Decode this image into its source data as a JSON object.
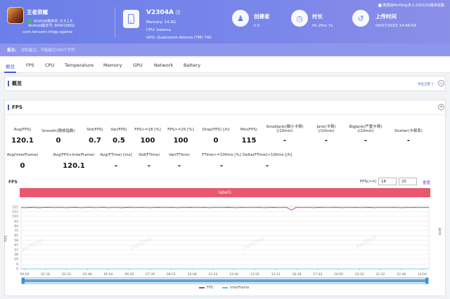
{
  "header": {
    "app_name": "王者荣耀",
    "android_version": "Android版本名: 8.4.1.6",
    "android_code": "Android版本号: 804010602",
    "package": "com.tencent.tmgp.sgame",
    "device_name": "V2304A",
    "memory": "Memory: 14.9G",
    "cpu": "CPU: kalama",
    "gpu": "GPU: Qualcomm Adreno (TM) 740",
    "creator_label": "创建者",
    "creator_value": "li li",
    "duration_label": "时长",
    "duration_value": "0h 25m 7s",
    "upload_label": "上传时间",
    "upload_value": "04/07/2023 14:46:54",
    "source_note": "数据由PerfDog(8.1.230120)版本收集",
    "note_label": "备注:",
    "note_placeholder": "添加备注，不能超过200个字符"
  },
  "tabs": [
    "概览",
    "FPS",
    "CPU",
    "Temperature",
    "Memory",
    "GPU",
    "Network",
    "Battery"
  ],
  "overview": {
    "title": "概览",
    "export_label": "导出全部"
  },
  "fps_panel": {
    "title": "FPS",
    "row1": [
      {
        "label": "Avg(FPS)",
        "value": "120.1"
      },
      {
        "label": "Smooth(稳帧指数)",
        "value": "0"
      },
      {
        "label": "Std(FPS)",
        "value": "0.7"
      },
      {
        "label": "Var(FPS)",
        "value": "0.5"
      },
      {
        "label": "FPS>=18 [%]",
        "value": "100"
      },
      {
        "label": "FPS>=25 [%]",
        "value": "100"
      },
      {
        "label": "Drop(FPS) [/h]",
        "value": "0"
      },
      {
        "label": "Min(FPS)",
        "value": "115"
      },
      {
        "label": "SmallJank(微小卡顿)",
        "label2": "(/10min)",
        "value": "-"
      },
      {
        "label": "Jank(卡顿)",
        "label2": "(/10min)",
        "value": "-"
      },
      {
        "label": "BigJank(严重卡顿)",
        "label2": "(/10min)",
        "value": "-"
      },
      {
        "label": "Stutter(卡顿率)",
        "value": "-"
      }
    ],
    "row2": [
      {
        "label": "Avg(InterFrame)",
        "value": "0"
      },
      {
        "label": "Avg(FPS+InterFrame)",
        "value": "120.1"
      },
      {
        "label": "Avg(FTime) [ms]",
        "value": "-"
      },
      {
        "label": "Std(FTime)",
        "value": "-"
      },
      {
        "label": "Var(FTime)",
        "value": "-"
      },
      {
        "label": "FTime>=100ms [%]",
        "value": "-"
      },
      {
        "label": "Delta(FTime)>100ms [/h]",
        "value": "-"
      }
    ]
  },
  "chart_controls": {
    "title": "FPS",
    "threshold_label": "FPS(>=)",
    "threshold_low": "18",
    "threshold_high": "25",
    "reset_label": "重置",
    "band_label": "label1",
    "watermark": "PerfDog"
  },
  "colors": {
    "accent": "#4a5bd9",
    "fps_line": "#b03ca0",
    "interframe_line": "#4fc3e8",
    "band": "#e9586e"
  },
  "chart_data": {
    "type": "line",
    "ylabel": "FPS",
    "ylabel_right": "Jank",
    "ylim": [
      0,
      121
    ],
    "yticks": [
      "121",
      "112",
      "103",
      "93",
      "84",
      "75",
      "65",
      "56",
      "47",
      "37",
      "28",
      "19",
      "9",
      "0"
    ],
    "xticks": [
      "00:00",
      "01:16",
      "02:32",
      "03:48",
      "05:04",
      "06:20",
      "07:36",
      "08:52",
      "10:08",
      "11:24",
      "12:40",
      "13:56",
      "15:12",
      "16:28",
      "17:44",
      "19:00",
      "20:16",
      "21:32",
      "22:48",
      "24:04"
    ],
    "series": [
      {
        "name": "FPS",
        "values": [
          120.1,
          119.8,
          120.3,
          120.0,
          119.6,
          120.2,
          120.4,
          119.9,
          120.1,
          120.0,
          119.7,
          120.2,
          120.3,
          119.8,
          120.1,
          120.2,
          119.9,
          120.0,
          120.4,
          119.8,
          120.1,
          120.0,
          119.6,
          120.3,
          120.1,
          119.9,
          120.2,
          120.0,
          119.8,
          120.1,
          120.3,
          119.9,
          120.0,
          120.2,
          119.7,
          120.1,
          120.0,
          120.3,
          119.9,
          120.1,
          120.2,
          119.8,
          120.0,
          120.1,
          119.9,
          120.3,
          120.0,
          119.8,
          120.2,
          120.1,
          119.9,
          120.0,
          120.2,
          119.8,
          120.1,
          120.3,
          119.9,
          120.0,
          120.1,
          115.0,
          120.2,
          119.9,
          120.1,
          120.0,
          119.8,
          120.3,
          120.1,
          119.9,
          120.0,
          120.2,
          119.8,
          120.1,
          120.0,
          120.2,
          119.9,
          120.1,
          120.3,
          119.8,
          120.0,
          120.1,
          119.9,
          120.2,
          120.0,
          119.8,
          120.1,
          120.0,
          120.2,
          119.9,
          120.1,
          120.0
        ]
      },
      {
        "name": "InterFrame",
        "values": [
          0,
          0,
          0,
          0,
          0,
          0,
          0,
          0,
          0,
          0,
          0,
          0,
          0,
          0,
          0,
          0,
          0,
          0,
          0,
          0,
          0,
          0,
          0,
          0,
          0,
          0,
          0,
          0,
          0,
          0,
          0,
          0,
          0,
          0,
          0,
          0,
          0,
          0,
          0,
          0,
          0,
          0,
          0,
          0,
          0,
          0,
          0,
          0,
          0,
          0,
          0,
          0,
          0,
          0,
          0,
          0,
          0,
          0,
          0,
          0,
          0,
          0,
          0,
          0,
          0,
          0,
          0,
          0,
          0,
          0,
          0,
          0,
          0,
          0,
          0,
          0,
          0,
          0,
          0,
          0,
          0,
          0,
          0,
          0,
          0,
          0,
          0,
          0,
          0,
          0
        ]
      }
    ],
    "legend": [
      "FPS",
      "InterFrame"
    ],
    "legend_position": "bottom-center",
    "grid": true
  }
}
